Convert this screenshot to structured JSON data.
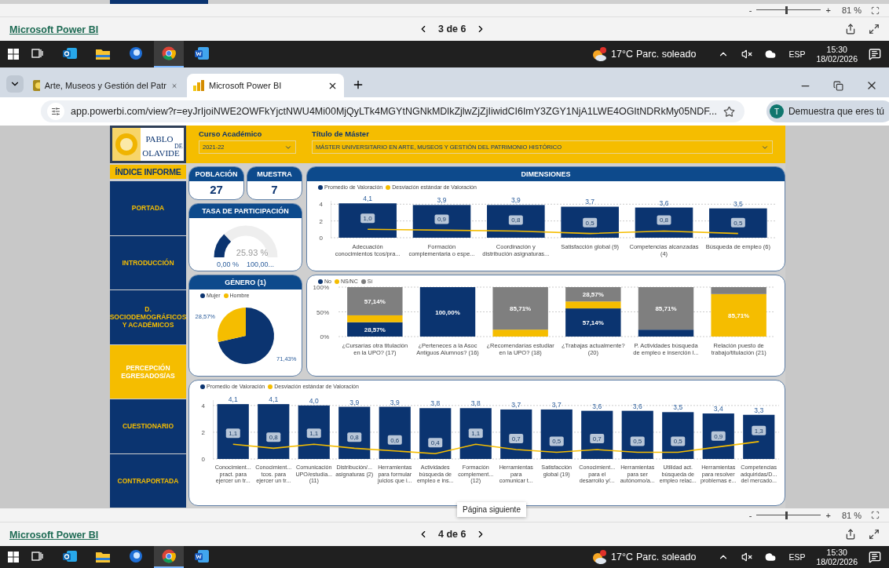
{
  "upper_viewer_bar": {
    "zoom_out": "-",
    "zoom_in": "+",
    "level": 0.45,
    "zoom_value": "81 %",
    "title": "Microsoft Power BI",
    "page": "3 de 6"
  },
  "upper_taskbar": {
    "apps": [
      {
        "kind": "mail",
        "selected": false
      },
      {
        "kind": "folder",
        "selected": false
      },
      {
        "kind": "globe",
        "selected": false
      },
      {
        "kind": "browser",
        "selected": true
      },
      {
        "kind": "document",
        "selected": false
      }
    ],
    "temperature": "17°C",
    "condition": "Parc. soleado",
    "language": "ESP",
    "time": "15:30",
    "date": "18/02/2026"
  },
  "browser": {
    "tabs": [
      {
        "title": "Arte, Museos y Gestión del Patr",
        "kind": "museum",
        "selected": false
      },
      {
        "title": "Microsoft Power BI",
        "kind": "report",
        "selected": true
      }
    ],
    "url": "app.powerbi.com/view?r=eyJrIjoiNWE2OWFkYjctNWU4Mi00MjQyLTk4MGYtNGNkMDlkZjlwZjZjIiwidCI6ImY3ZGY1NjA1LWE4OGItNDRkMy05NDF...",
    "profile": "Demuestra que eres tú",
    "avatar_letter": "T"
  },
  "report": {
    "logo": {
      "top": "PABLO",
      "middle": "DE",
      "bottom": "OLAVIDE"
    },
    "filters": [
      {
        "label": "Curso Académico",
        "value": "2021-22"
      },
      {
        "label": "Título de Máster",
        "value": "MÁSTER UNIVERSITARIO EN ARTE, MUSEOS Y GESTIÓN DEL PATRIMONIO HISTÓRICO"
      }
    ],
    "index_title": "ÍNDICE INFORME",
    "nav": [
      {
        "label": "PORTADA",
        "selected": false
      },
      {
        "label": "INTRODUCCIÓN",
        "selected": false
      },
      {
        "label": "D. SOCIODEMOGRÁFICOS Y ACADÉMICOS",
        "selected": false
      },
      {
        "label": "PERCEPCIÓN EGRESADOS/AS",
        "selected": true
      },
      {
        "label": "CUESTIONARIO",
        "selected": false
      },
      {
        "label": "CONTRAPORTADA",
        "selected": false
      }
    ],
    "kpis": [
      {
        "title": "POBLACIÓN",
        "value": "27"
      },
      {
        "title": "MUESTRA",
        "value": "7"
      }
    ],
    "participation": {
      "title": "TASA DE PARTICIPACIÓN",
      "value": "25.93 %",
      "level": 0.2593,
      "min": "0,00 %",
      "max": "100,00..."
    },
    "dimensions": {
      "title": "DIMENSIONES",
      "chart_data": {
        "type": "bar",
        "legend": "top",
        "categories": [
          "Adecuación\nconocimientos tcos/pra...",
          "Formación\ncomplementaria o espe...",
          "Coordinación y\ndistribución asignaturas...",
          "Satisfacción global (9)",
          "Competencias alcanzadas\n(4)",
          "Búsqueda de empleo (6)"
        ],
        "series": [
          {
            "name": "Promedio de Valoración",
            "type": "bar",
            "color": "#0b3470",
            "values": [
              4.1,
              3.9,
              3.9,
              3.7,
              3.6,
              3.5
            ]
          },
          {
            "name": "Desviación estándar de Valoración",
            "type": "line",
            "color": "#f5bd00",
            "values": [
              1.0,
              0.9,
              0.8,
              0.5,
              0.8,
              0.5
            ]
          }
        ],
        "value_labels": [
          [
            "4,1",
            "3,9",
            "3,9",
            "3,7",
            "3,6",
            "3,5"
          ],
          [
            "1,0",
            "0,9",
            "0,8",
            "0,5",
            "0,8",
            "0,5"
          ]
        ],
        "ylim": [
          0,
          4.4
        ],
        "yticks": [
          0,
          2,
          4
        ]
      }
    },
    "gender": {
      "title": "GÉNERO (1)",
      "chart_data": {
        "type": "pie",
        "legend": "top",
        "categories": [
          "Mujer",
          "Hombre"
        ],
        "series": [
          {
            "colors": [
              "#0b3470",
              "#f5bd00"
            ],
            "values": [
              71.43,
              28.57
            ]
          }
        ],
        "value_labels": [
          [
            "71,43%",
            "28,57%"
          ]
        ]
      }
    },
    "questions": {
      "chart_data": {
        "type": "bar",
        "stacked": true,
        "legend": "top",
        "categories": [
          "¿Cursarías otra titulación\nen la UPO? (17)",
          "¿Perteneces a la Asoc\nAntiguos Alumnos? (16)",
          "¿Recomendarías estudiar\nen la UPO? (18)",
          "¿Trabajas actualmente?\n(20)",
          "P. Actividades búsqueda\nde empleo e inserción l...",
          "Relación puesto de\ntrabajo/titulación (21)"
        ],
        "series": [
          {
            "name": "No",
            "color": "#0b3470",
            "values": [
              29,
              100,
              0,
              57,
              14,
              0
            ]
          },
          {
            "name": "NS/NC",
            "color": "#f5bd00",
            "values": [
              14,
              0,
              14,
              14,
              0,
              86
            ]
          },
          {
            "name": "Sí",
            "color": "#7f7f7f",
            "values": [
              57,
              0,
              86,
              29,
              86,
              14
            ]
          }
        ],
        "value_labels": [
          [
            "28,57%",
            "100,00%",
            null,
            "57,14%",
            null,
            null
          ],
          [
            null,
            null,
            null,
            null,
            null,
            "85,71%"
          ],
          [
            "57,14%",
            null,
            "85,71%",
            "28,57%",
            "85,71%",
            null
          ]
        ],
        "ylim": [
          0,
          100
        ],
        "yticks": [
          {
            "value": 0,
            "label": "0%"
          },
          {
            "value": 50,
            "label": "50%"
          },
          {
            "value": 100,
            "label": "100%"
          }
        ]
      }
    },
    "items": {
      "chart_data": {
        "type": "bar",
        "legend": "top",
        "categories": [
          "Conocimient...\npract. para\nejercer un tr...",
          "Conocimient...\ntcos. para\nejercer un tr...",
          "Comunicación\nUPO/estudia...\n(11)",
          "Distribución/...\nasignaturas (2)",
          "Herramientas\npara formular\njuicios que i...",
          "Actividades\nbúsqueda de\nempleo e ins...",
          "Formación\ncomplement...\n(12)",
          "Herramientas\npara\ncomunicar t...",
          "Satisfacción\nglobal (19)",
          "Conocimient...\npara el\ndesarrollo y/...",
          "Herramientas\npara ser\nautónomo/a...",
          "Utilidad act.\nbúsqueda de\nempleo relac...",
          "Herramientas\npara resolver\nproblemas e...",
          "Competencias\nadquiridas/D...\ndel mercado..."
        ],
        "series": [
          {
            "name": "Promedio de Valoración",
            "type": "bar",
            "color": "#0b3470",
            "values": [
              4.1,
              4.1,
              4.0,
              3.9,
              3.9,
              3.8,
              3.8,
              3.7,
              3.7,
              3.6,
              3.6,
              3.5,
              3.4,
              3.3
            ]
          },
          {
            "name": "Desviación estándar de Valoración",
            "type": "line",
            "color": "#f5bd00",
            "values": [
              1.1,
              0.8,
              1.1,
              0.8,
              0.6,
              0.4,
              1.1,
              0.7,
              0.5,
              0.7,
              0.5,
              0.5,
              0.9,
              1.3
            ]
          }
        ],
        "value_labels": [
          [
            "4,1",
            "4,1",
            "4,0",
            "3,9",
            "3,9",
            "3,8",
            "3,8",
            "3,7",
            "3,7",
            "3,6",
            "3,6",
            "3,5",
            "3,4",
            "3,3"
          ],
          [
            "1,1",
            "0,8",
            "1,1",
            "0,8",
            "0,6",
            "0,4",
            "1,1",
            "0,7",
            "0,5",
            "0,7",
            "0,5",
            "0,5",
            "0,9",
            "1,3"
          ]
        ],
        "ylim": [
          0,
          4.4
        ],
        "yticks": [
          0,
          2,
          4
        ]
      }
    }
  },
  "lower_viewer_bar": {
    "zoom_out": "-",
    "zoom_in": "+",
    "level": 0.45,
    "zoom_value": "81 %",
    "title": "Microsoft Power BI",
    "page": "4 de 6",
    "tooltip": "Página siguiente"
  },
  "lower_taskbar": {
    "apps": [
      {
        "kind": "mail",
        "selected": false
      },
      {
        "kind": "folder",
        "selected": false
      },
      {
        "kind": "globe",
        "selected": false
      },
      {
        "kind": "browser",
        "selected": true
      },
      {
        "kind": "document",
        "selected": false
      }
    ],
    "temperature": "17°C",
    "condition": "Parc. soleado",
    "language": "ESP",
    "time": "15:30",
    "date": "18/02/2026"
  }
}
